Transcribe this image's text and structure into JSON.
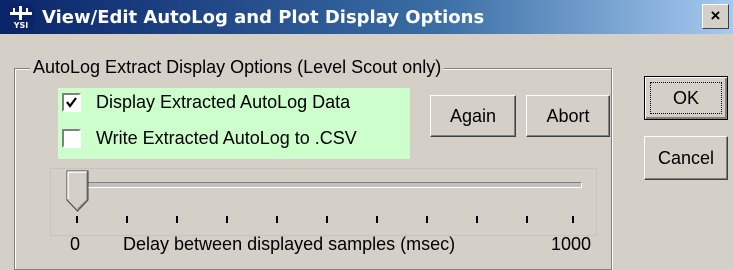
{
  "window": {
    "title": "View/Edit AutoLog and Plot Display Options",
    "close_label": "×"
  },
  "group": {
    "legend": "AutoLog Extract Display Options (Level Scout only)",
    "options": [
      {
        "label": "Display Extracted AutoLog Data",
        "checked": true
      },
      {
        "label": "Write Extracted AutoLog to .CSV",
        "checked": false
      }
    ],
    "again_label": "Again",
    "abort_label": "Abort"
  },
  "buttons": {
    "ok_label": "OK",
    "cancel_label": "Cancel"
  },
  "slider": {
    "min_label": "0",
    "max_label": "1000",
    "caption": "Delay between displayed samples (msec)",
    "value": 0
  },
  "colors": {
    "title_bar": "#0a246a",
    "option_highlight": "#ccffcc",
    "face": "#d4d0c8"
  },
  "icons": {
    "app": "ysi-logo-icon",
    "close": "close-icon",
    "check": "check-icon",
    "thumb": "slider-thumb"
  }
}
